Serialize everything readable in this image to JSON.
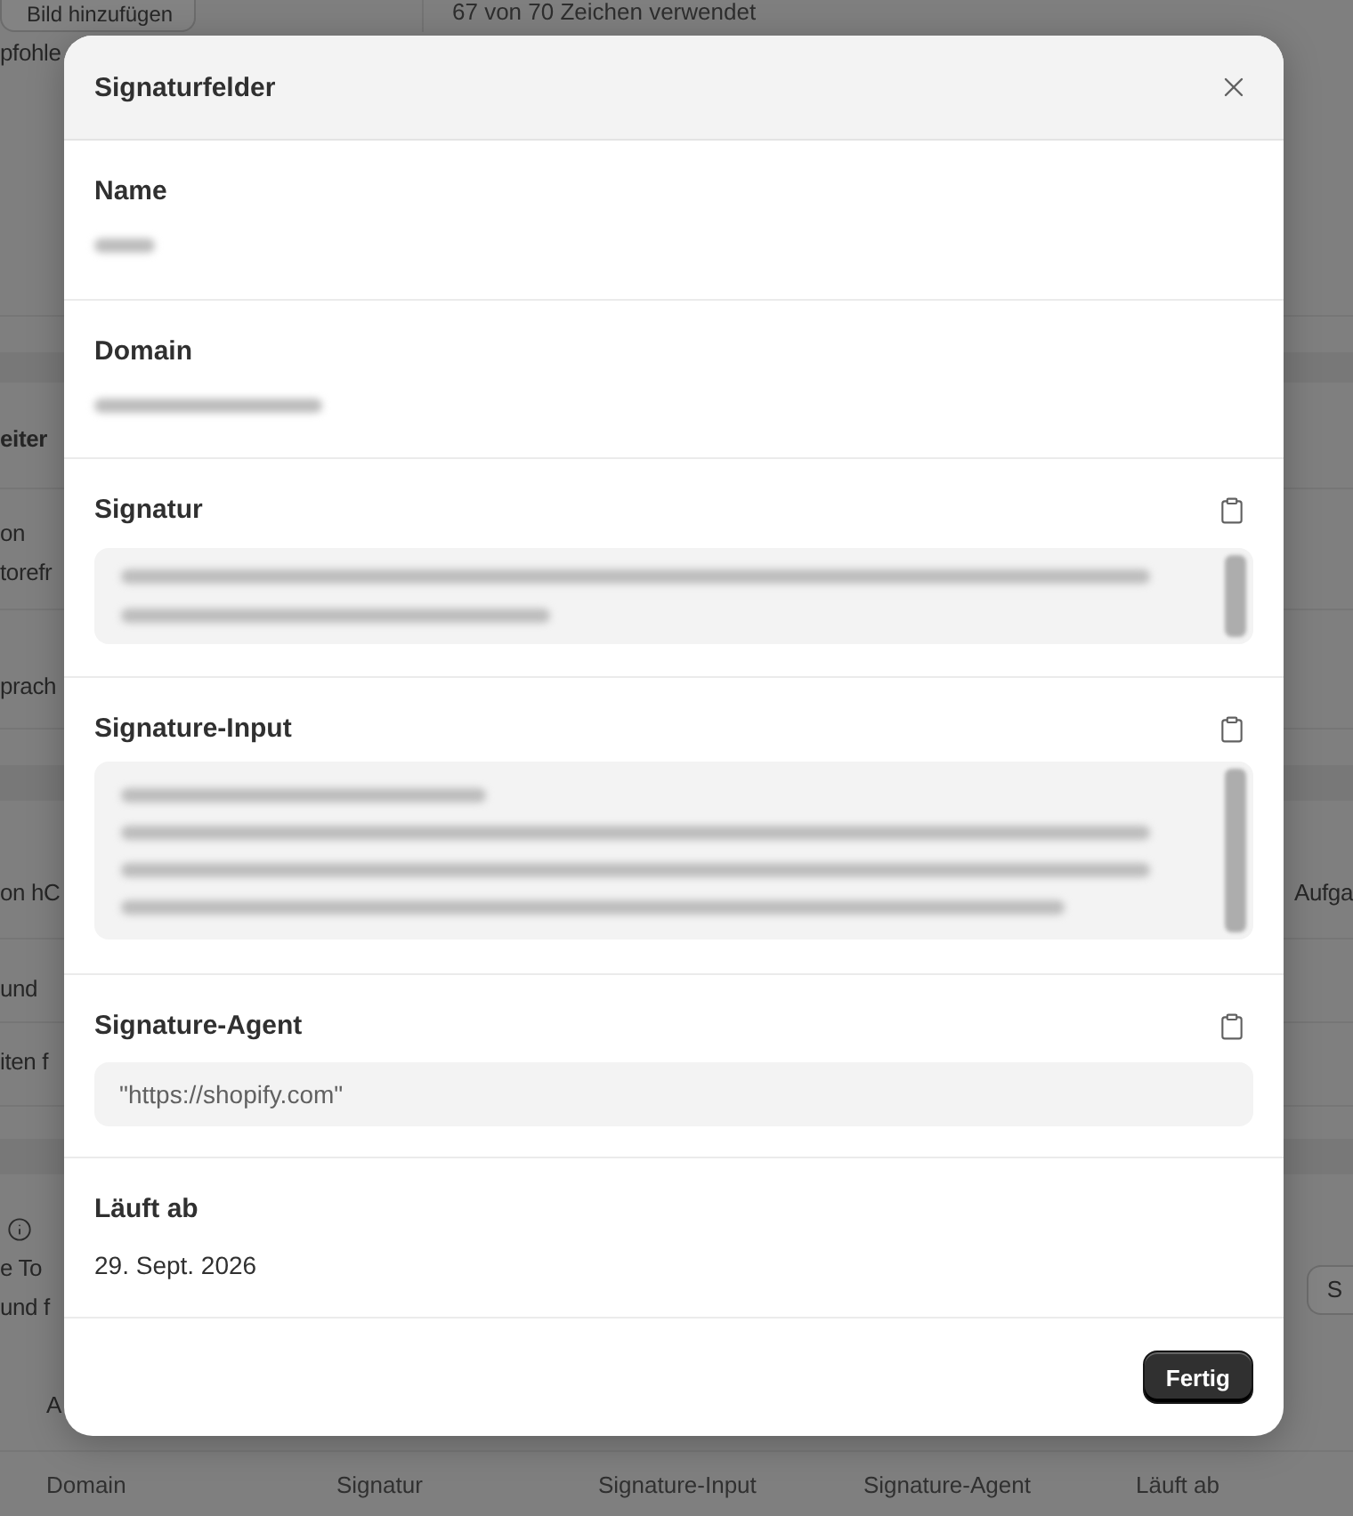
{
  "background": {
    "rows": [
      {
        "left": [
          {
            "kind": "button",
            "text": "Bild hinzufügen"
          }
        ],
        "right": [
          {
            "kind": "text",
            "text": "67 von 70 Zeichen verwendet"
          }
        ]
      },
      {
        "left": [
          {
            "kind": "text",
            "text": "pfohle"
          }
        ],
        "right": []
      },
      {
        "left": [
          {
            "kind": "heading",
            "text": "eiter"
          }
        ],
        "right": []
      },
      {
        "left": [
          {
            "kind": "text",
            "text": "on"
          },
          {
            "kind": "text",
            "text": "torefr"
          }
        ],
        "right": []
      },
      {
        "left": [
          {
            "kind": "text",
            "text": "prach"
          }
        ],
        "right": []
      },
      {
        "left": [
          {
            "kind": "text",
            "text": "on hC"
          }
        ],
        "right": [
          {
            "kind": "text",
            "text": "Aufga"
          }
        ]
      },
      {
        "left": [
          {
            "kind": "text",
            "text": "und"
          }
        ],
        "right": []
      },
      {
        "left": [
          {
            "kind": "text",
            "text": "iten f"
          }
        ],
        "right": []
      },
      {
        "left": [
          {
            "kind": "info"
          },
          {
            "kind": "text",
            "text": "e To"
          },
          {
            "kind": "text",
            "text": "und f"
          }
        ],
        "right": [
          {
            "kind": "button",
            "text": "S"
          }
        ]
      },
      {
        "left": [
          {
            "kind": "text",
            "text": "A"
          }
        ],
        "right": []
      }
    ],
    "table_columns": [
      "Domain",
      "Signatur",
      "Signature-Input",
      "Signature-Agent",
      "Läuft ab"
    ]
  },
  "dialog": {
    "title": "Signaturfelder",
    "fields": [
      {
        "label": "Name",
        "kind": "redacted-word",
        "copyable": false
      },
      {
        "label": "Domain",
        "kind": "redacted-line",
        "copyable": false
      },
      {
        "label": "Signatur",
        "kind": "redacted-box",
        "copyable": true
      },
      {
        "label": "Signature-Input",
        "kind": "redacted-tall-box",
        "copyable": true
      },
      {
        "label": "Signature-Agent",
        "kind": "code",
        "value": "\"https://shopify.com\"",
        "copyable": true
      },
      {
        "label": "Läuft ab",
        "kind": "text",
        "value": "29. Sept. 2026",
        "copyable": false
      }
    ],
    "done_button": "Fertig"
  }
}
